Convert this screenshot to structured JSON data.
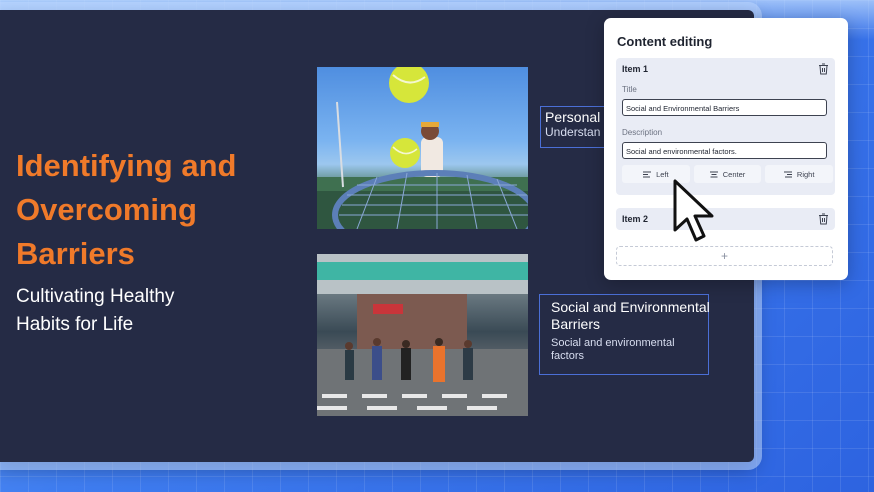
{
  "slide": {
    "title": "Identifying and Overcoming Barriers",
    "subtitle": "Cultivating Healthy Habits for Life",
    "title_color": "#f07a2a",
    "background_color": "#252b45",
    "captions": [
      {
        "title": "Personal",
        "description": "Understan"
      },
      {
        "title": "Social and Environmental Barriers",
        "description": "Social and environmental factors"
      }
    ]
  },
  "panel": {
    "title": "Content editing",
    "items": [
      {
        "label": "Item 1",
        "title_label": "Title",
        "title_value": "Social and Environmental Barriers",
        "description_label": "Description",
        "description_value": "Social and environmental factors."
      },
      {
        "label": "Item 2"
      }
    ],
    "align_buttons": [
      "Left",
      "Center",
      "Right"
    ],
    "add_label": "+"
  },
  "icons": {
    "delete": "trash-icon",
    "align_left": "align-left-icon",
    "align_center": "align-center-icon",
    "align_right": "align-right-icon",
    "pointer": "mouse-pointer-icon"
  }
}
